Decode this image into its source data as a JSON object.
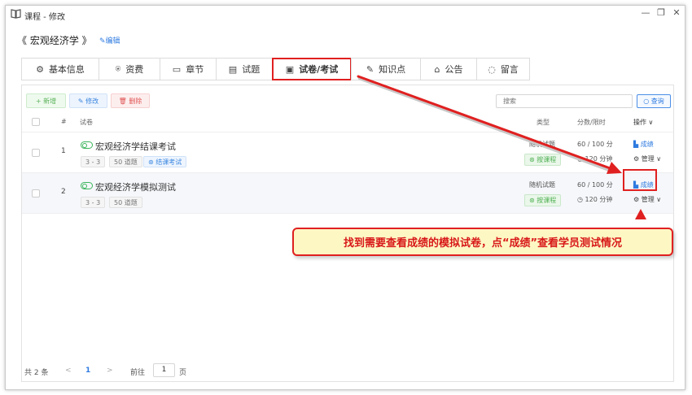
{
  "window": {
    "title": "课程 - 修改",
    "controls": {
      "minimize": "—",
      "restore": "❐",
      "close": "✕"
    }
  },
  "course": {
    "name": "《 宏观经济学 》",
    "edit_label": "✎编辑"
  },
  "tabs": [
    {
      "label": "基本信息",
      "icon": "gear-icon",
      "glyph": "⚙"
    },
    {
      "label": "资费",
      "icon": "money-bag-icon",
      "glyph": "⍟"
    },
    {
      "label": "章节",
      "icon": "chapter-icon",
      "glyph": "▭"
    },
    {
      "label": "试题",
      "icon": "questions-icon",
      "glyph": "▤"
    },
    {
      "label": "试卷/考试",
      "icon": "exam-paper-icon",
      "glyph": "▣",
      "active": true
    },
    {
      "label": "知识点",
      "icon": "knowledge-icon",
      "glyph": "✎"
    },
    {
      "label": "公告",
      "icon": "announcement-icon",
      "glyph": "⌂"
    },
    {
      "label": "留言",
      "icon": "message-icon",
      "glyph": "◌"
    }
  ],
  "toolbar": {
    "add_label": "+ 新增",
    "edit_label": "✎ 修改",
    "delete_label": "🗑 删除"
  },
  "search": {
    "placeholder": "搜索",
    "button_label": "○ 查询"
  },
  "table": {
    "headers": {
      "index": "#",
      "paper": "试卷",
      "type": "类型",
      "score_time": "分数/限时",
      "ops": "操作 ∨"
    },
    "rows": [
      {
        "index": "1",
        "name": "宏观经济学结课考试",
        "tags": [
          "3 - 3",
          "50 道题"
        ],
        "extra_tag": "⊛ 结课考试",
        "type": "随机试题",
        "course_tag": "⊛ 按课程",
        "score": "60 / 100 分",
        "time": "◷ 120 分钟",
        "result_label": "▙ 成绩",
        "manage_label": "⚙ 管理 ∨"
      },
      {
        "index": "2",
        "name": "宏观经济学模拟测试",
        "tags": [
          "3 - 3",
          "50 道题"
        ],
        "type": "随机试题",
        "course_tag": "⊛ 按课程",
        "score": "60 / 100 分",
        "time": "◷ 120 分钟",
        "result_label": "▙ 成绩",
        "manage_label": "⚙ 管理 ∨"
      }
    ]
  },
  "annotation": {
    "callout_text": "找到需要查看成绩的模拟试卷，点“成绩”查看学员测试情况",
    "color": "#e02020"
  },
  "pagination": {
    "total": "共 2 条",
    "prev": "<",
    "current": "1",
    "next": ">",
    "goto_label": "前往",
    "page_value": "1",
    "page_suffix": "页"
  }
}
